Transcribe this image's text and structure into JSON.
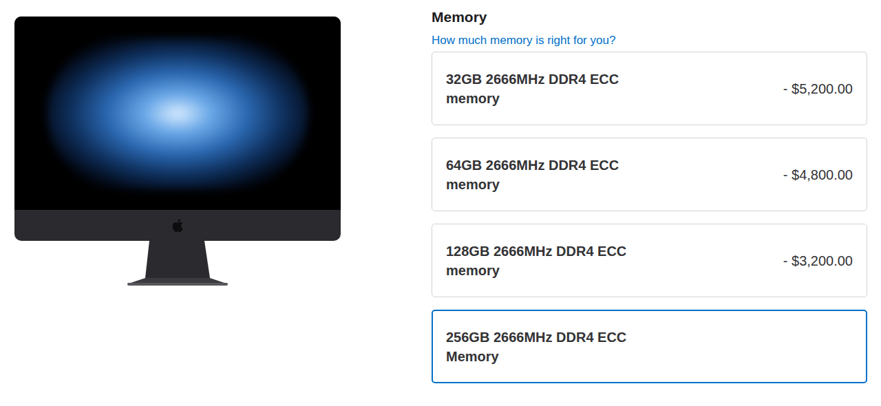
{
  "section": {
    "title": "Memory",
    "help_link": "How much memory is right for you?"
  },
  "options": [
    {
      "name": "32GB 2666MHz DDR4 ECC",
      "unit": "memory",
      "price": "- $5,200.00",
      "selected": false
    },
    {
      "name": "64GB 2666MHz DDR4 ECC",
      "unit": "memory",
      "price": "- $4,800.00",
      "selected": false
    },
    {
      "name": "128GB 2666MHz DDR4 ECC",
      "unit": "memory",
      "price": "- $3,200.00",
      "selected": false
    },
    {
      "name": "256GB 2666MHz DDR4 ECC",
      "unit": "Memory",
      "price": "",
      "selected": true
    }
  ]
}
